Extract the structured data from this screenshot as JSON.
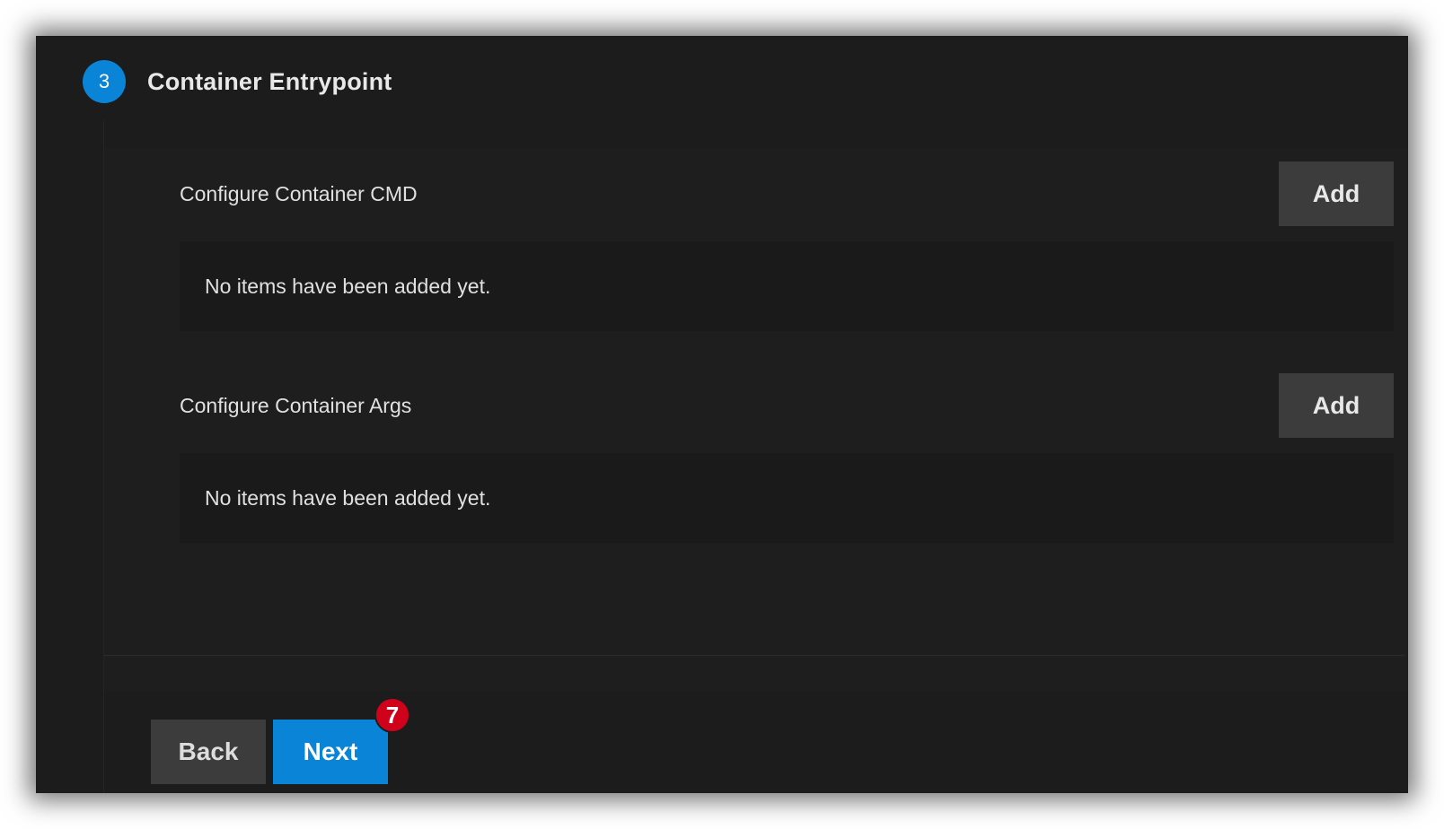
{
  "step": {
    "number": "3",
    "title": "Container Entrypoint"
  },
  "sections": [
    {
      "label": "Configure Container CMD",
      "add_label": "Add",
      "empty_text": "No items have been added yet."
    },
    {
      "label": "Configure Container Args",
      "add_label": "Add",
      "empty_text": "No items have been added yet."
    }
  ],
  "footer": {
    "back_label": "Back",
    "next_label": "Next",
    "badge": "7"
  },
  "colors": {
    "accent": "#0a84d6",
    "badge": "#d0021b",
    "background": "#1c1c1c"
  }
}
